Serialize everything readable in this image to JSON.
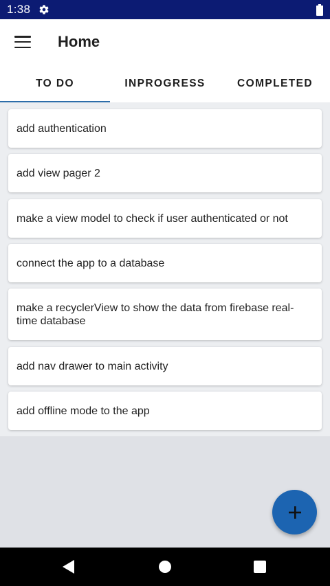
{
  "status_bar": {
    "time": "1:38",
    "settings_icon": "gear-icon",
    "battery_icon": "battery-icon"
  },
  "app_bar": {
    "menu_icon": "hamburger-menu-icon",
    "title": "Home"
  },
  "tabs": [
    {
      "label": "TO DO",
      "active": true
    },
    {
      "label": "INPROGRESS",
      "active": false
    },
    {
      "label": "COMPLETED",
      "active": false
    }
  ],
  "tasks": [
    {
      "text": "add authentication"
    },
    {
      "text": "add view pager 2"
    },
    {
      "text": "make a view model to check if user authenticated or not"
    },
    {
      "text": "connect the app to a database"
    },
    {
      "text": "make a recyclerView to show the data from firebase real-time database"
    },
    {
      "text": "add nav drawer to main activity"
    },
    {
      "text": "add offline mode to the app"
    }
  ],
  "fab": {
    "icon": "plus-icon"
  },
  "nav_bar": {
    "back_icon": "back-triangle-icon",
    "home_icon": "home-circle-icon",
    "recents_icon": "recents-square-icon"
  },
  "colors": {
    "status_bar": "#0c1b73",
    "accent": "#2c6da9",
    "fab": "#1c64b1",
    "background": "#dfe1e6"
  }
}
